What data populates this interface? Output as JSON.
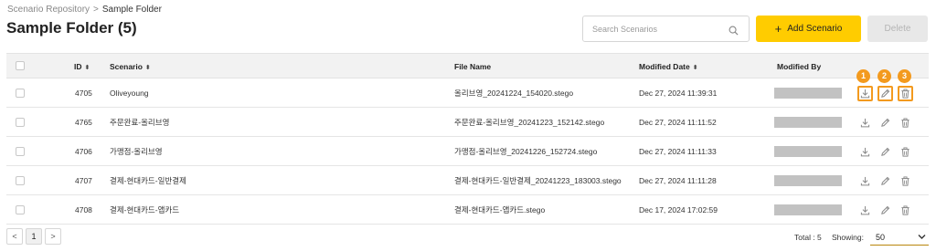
{
  "breadcrumb": {
    "root": "Scenario Repository",
    "separator": ">",
    "current": "Sample Folder"
  },
  "page_title": "Sample Folder (5)",
  "search": {
    "placeholder": "Search Scenarios",
    "value": ""
  },
  "buttons": {
    "add_plus": "+",
    "add_label": "Add Scenario",
    "delete_label": "Delete"
  },
  "table": {
    "headers": {
      "id": "ID",
      "scenario": "Scenario",
      "file_name": "File Name",
      "modified_date": "Modified Date",
      "modified_by": "Modified By",
      "sort_icon": "⬍"
    },
    "rows": [
      {
        "id": "4705",
        "scenario": "Oliveyoung",
        "file_name": "올리브영_20241224_154020.stego",
        "modified_date": "Dec 27, 2024 11:39:31"
      },
      {
        "id": "4765",
        "scenario": "주문완료-올리브영",
        "file_name": "주문완료-올리브영_20241223_152142.stego",
        "modified_date": "Dec 27, 2024 11:11:52"
      },
      {
        "id": "4706",
        "scenario": "가맹점-올리브영",
        "file_name": "가맹점-올리브영_20241226_152724.stego",
        "modified_date": "Dec 27, 2024 11:11:33"
      },
      {
        "id": "4707",
        "scenario": "결제-현대카드-일반결제",
        "file_name": "결제-현대카드-일반결제_20241223_183003.stego",
        "modified_date": "Dec 27, 2024 11:11:28"
      },
      {
        "id": "4708",
        "scenario": "결제-현대카드-앱카드",
        "file_name": "결제-현대카드-앱카드.stego",
        "modified_date": "Dec 17, 2024 17:02:59"
      }
    ],
    "action_icons": [
      "download-icon",
      "edit-pencil-icon",
      "trash-icon"
    ],
    "annotation_badges": [
      "1",
      "2",
      "3"
    ]
  },
  "pagination": {
    "prev": "<",
    "current_page": "1",
    "next": ">"
  },
  "footer": {
    "total_label": "Total : 5",
    "showing_label": "Showing:",
    "showing_value": "50"
  },
  "colors": {
    "accent": "#ffcc00",
    "highlight": "#f39a1e",
    "masked": "#c2c2c2",
    "header_bg": "#f2f2f2"
  }
}
